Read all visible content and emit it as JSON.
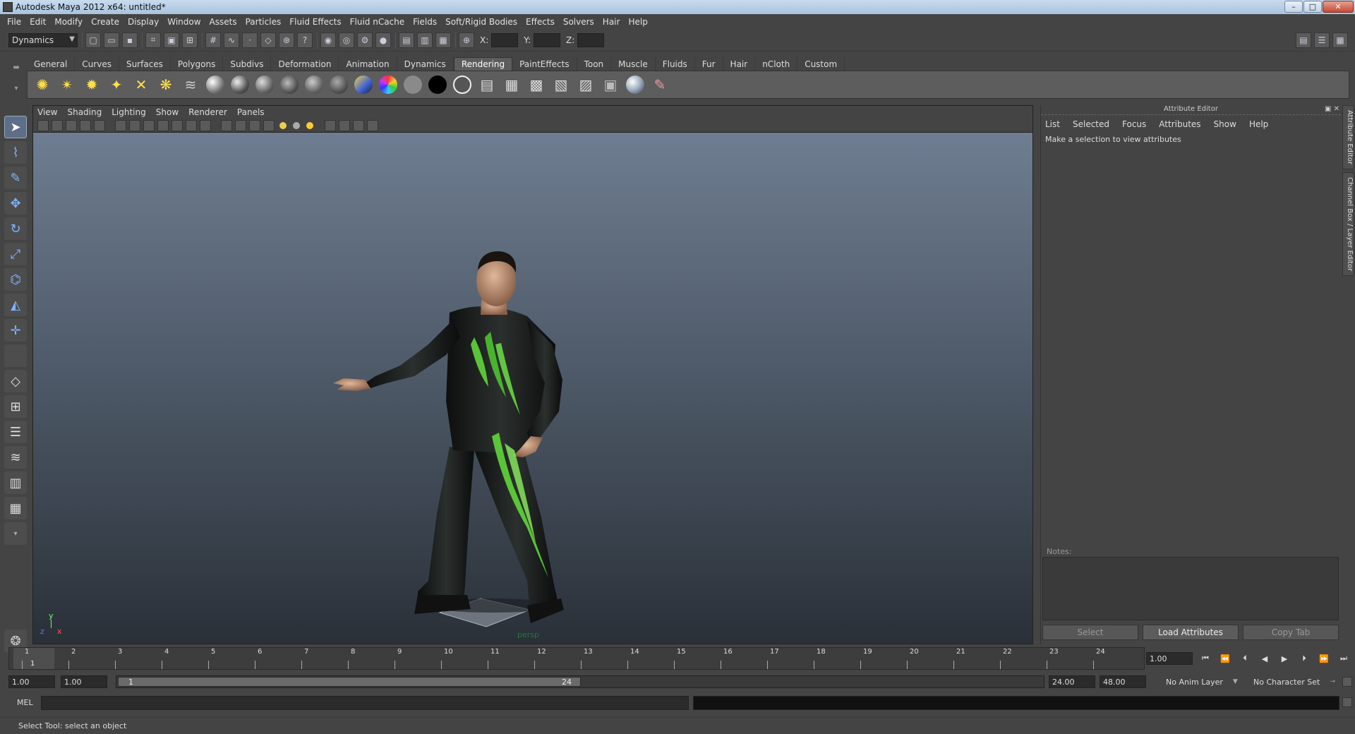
{
  "window": {
    "title": "Autodesk Maya 2012 x64: untitled*",
    "minimize": "–",
    "maximize": "□",
    "close": "✕"
  },
  "menubar": [
    "File",
    "Edit",
    "Modify",
    "Create",
    "Display",
    "Window",
    "Assets",
    "Particles",
    "Fluid Effects",
    "Fluid nCache",
    "Fields",
    "Soft/Rigid Bodies",
    "Effects",
    "Solvers",
    "Hair",
    "Help"
  ],
  "statusline": {
    "mode": "Dynamics",
    "x_label": "X:",
    "y_label": "Y:",
    "z_label": "Z:"
  },
  "shelf": {
    "tabs": [
      "General",
      "Curves",
      "Surfaces",
      "Polygons",
      "Subdivs",
      "Deformation",
      "Animation",
      "Dynamics",
      "Rendering",
      "PaintEffects",
      "Toon",
      "Muscle",
      "Fluids",
      "Fur",
      "Hair",
      "nCloth",
      "Custom"
    ],
    "active_tab": "Rendering"
  },
  "viewport": {
    "menu": [
      "View",
      "Shading",
      "Lighting",
      "Show",
      "Renderer",
      "Panels"
    ],
    "camera_label": "persp",
    "axis": {
      "x": "x",
      "y": "y",
      "z": "z"
    }
  },
  "attribute_editor": {
    "title": "Attribute Editor",
    "menu": [
      "List",
      "Selected",
      "Focus",
      "Attributes",
      "Show",
      "Help"
    ],
    "message": "Make a selection to view attributes",
    "notes_label": "Notes:",
    "buttons": {
      "select": "Select",
      "load": "Load Attributes",
      "copy": "Copy Tab"
    }
  },
  "side_tabs": [
    "Attribute Editor",
    "Channel Box / Layer Editor"
  ],
  "timeslider": {
    "ticks": [
      "1",
      "2",
      "3",
      "4",
      "5",
      "6",
      "7",
      "8",
      "9",
      "10",
      "11",
      "12",
      "13",
      "14",
      "15",
      "16",
      "17",
      "18",
      "19",
      "20",
      "21",
      "22",
      "23",
      "24"
    ],
    "current_frame": "1",
    "current_time": "1.00"
  },
  "range": {
    "start_time": "1.00",
    "playback_start": "1.00",
    "range_start": "1",
    "range_end": "24",
    "playback_end": "24.00",
    "end_time": "48.00",
    "anim_layer": "No Anim Layer",
    "character_set": "No Character Set"
  },
  "cmdline": {
    "label": "MEL"
  },
  "helpline": {
    "text": "Select Tool: select an object"
  },
  "colors": {
    "background": "#444444",
    "viewport_top": "#6e7d91",
    "viewport_bottom": "#2a3038",
    "suit_accent": "#5fd63a"
  }
}
